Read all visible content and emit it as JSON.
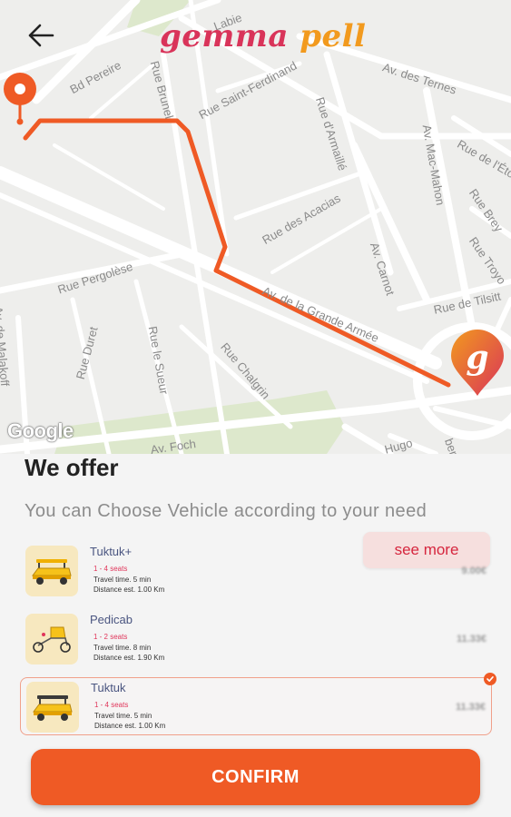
{
  "brand": {
    "part1": "gemma",
    "part2": "pell"
  },
  "map": {
    "streets": [
      "Bd Pereire",
      "Rue Brunel",
      "Rue Saint-Ferdinand",
      "Av. des Ternes",
      "Labie",
      "Rue d'Armaillé",
      "Av. Mac-Mahon",
      "Rue de l'Étoi",
      "Rue Brey",
      "Rue Troyo",
      "Rue des Acacias",
      "Av. Carnot",
      "Rue Pergolèse",
      "Rue de Tilsitt",
      "Av. de la Grande Armée",
      "Av. de Malakoff",
      "Rue Duret",
      "Rue le Sueur",
      "Rue Chalgrin",
      "Av. Foch",
      "Hugo",
      "ber"
    ],
    "attribution": "Google"
  },
  "sheet": {
    "title": "We offer",
    "subtitle": "You can Choose Vehicle according to your need",
    "see_more": "see more"
  },
  "vehicles": [
    {
      "name": "Tuktuk+",
      "seats": "1 - 4 seats",
      "travel_time": "Travel time. 5 min",
      "distance": "Distance est. 1.00 Km",
      "price": "9.00€",
      "selected": false
    },
    {
      "name": "Pedicab",
      "seats": "1 - 2 seats",
      "travel_time": "Travel time. 8 min",
      "distance": "Distance est. 1.90 Km",
      "price": "11.33€",
      "selected": false
    },
    {
      "name": "Tuktuk",
      "seats": "1 - 4 seats",
      "travel_time": "Travel time. 5 min",
      "distance": "Distance est. 1.00 Km",
      "price": "11.33€",
      "selected": true
    }
  ],
  "confirm_label": "CONFIRM",
  "colors": {
    "accent": "#ef5a25",
    "route": "#ef5a25",
    "brand_pink": "#d9345a",
    "brand_orange": "#f29a1e",
    "seats": "#e0355a"
  }
}
